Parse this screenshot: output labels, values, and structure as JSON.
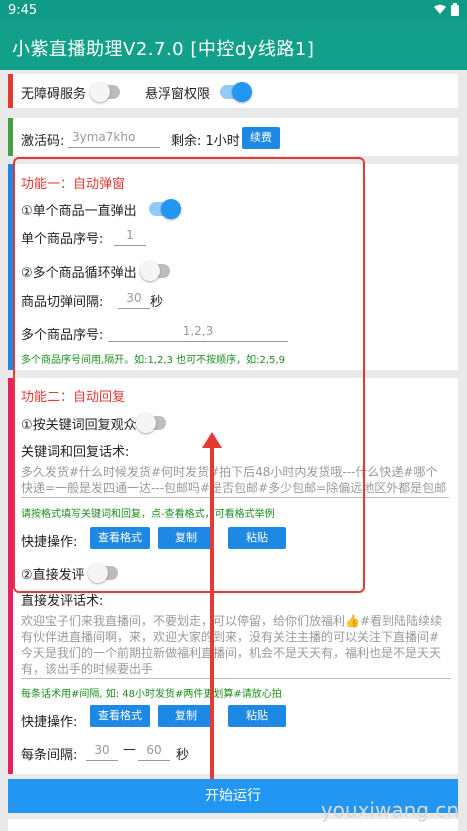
{
  "status_bar": {
    "time": "9:45"
  },
  "app": {
    "title": "小紫直播助理V2.7.0 [中控dy线路1]"
  },
  "permissions": {
    "accessibility_label": "无障碍服务",
    "overlay_label": "悬浮窗权限"
  },
  "activation": {
    "code_label": "激活码:",
    "code_value": "3yma7kho",
    "remaining_label": "剩余: 1小时",
    "renew_label": "续费"
  },
  "feature1": {
    "title": "功能一：自动弹窗",
    "single_label": "①单个商品一直弹出",
    "single_index_label": "单个商品序号:",
    "single_index_value": "1",
    "multi_label": "②多个商品循环弹出",
    "interval_label": "商品切弹间隔:",
    "interval_value": "30",
    "interval_unit": "秒",
    "multi_index_label": "多个商品序号:",
    "multi_index_value": "1,2,3",
    "hint": "多个商品序号间用,隔开。如:1,2,3 也可不按顺序，如:2,5,9"
  },
  "feature2": {
    "title": "功能二：自动回复",
    "keyword_reply_label": "①按关键词回复观众",
    "keyword_text_label": "关键词和回复话术:",
    "keyword_text_value": "多久发货#什么时候发货#何时发货#拍下后48小时内发货哦---什么快递#哪个快递=一般是发四通一达---包邮吗#是否包邮#多少包邮=除偏远地区外都是包邮的哦",
    "keyword_hint": "请按格式填写关键词和回复，点-查看格式，可看格式举例",
    "quick_ops_label": "快捷操作:",
    "btn_view_format": "查看格式",
    "btn_copy": "复制",
    "btn_paste": "粘贴",
    "direct_comment_label": "②直接发评",
    "direct_text_label": "直接发评话术:",
    "direct_text_value": "欢迎宝子们来我直播间，不要划走，可以停留，给你们放福利👍#看到陆陆续续有伙伴进直播间啊，来，欢迎大家的到来，没有关注主播的可以关注下直播间#今天是我们的一个前期拉新做福利直播间，机会不是天天有，福利也是不是天天有，该出手的时候要出手",
    "direct_hint": "每条话术用#间隔, 如: 48小时发货#两件更划算#请放心拍",
    "quick_ops_label2": "快捷操作:",
    "btn_view_format2": "查看格式",
    "btn_copy2": "复制",
    "btn_paste2": "粘贴",
    "each_interval_label": "每条间隔:",
    "interval_min": "30",
    "interval_dash": "—",
    "interval_max": "60",
    "interval_unit": "秒"
  },
  "start_button": "开始运行",
  "watermark": "youxiwang.cn",
  "colors": {
    "teal": "#13a08a",
    "red_bar": "#e53935",
    "green_bar": "#43a047",
    "blue_bar": "#1e88e5",
    "pink_bar": "#e91e63",
    "button_blue": "#1e88e5"
  }
}
